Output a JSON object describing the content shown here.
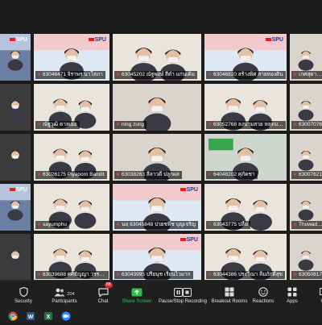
{
  "participants": [
    {
      "name": "",
      "scene": "logo-dark"
    },
    {
      "name": "63046471 จิราพร นาโสภา",
      "scene": "logo"
    },
    {
      "name": "63045202 ณัฐพงษ์ สีดำ แก่นเดิม",
      "scene": "two"
    },
    {
      "name": "63046820 สร้างพิศ สายทองดิน",
      "scene": "logo"
    },
    {
      "name": "เกศสุดา 6315",
      "scene": "plain"
    },
    {
      "name": "",
      "scene": "dark"
    },
    {
      "name": "ณัฐวุฒิ ตาลเยอ",
      "scene": "two"
    },
    {
      "name": "ning zung",
      "scene": "plain"
    },
    {
      "name": "63052768 ลงนามสวย หลุดบอส",
      "scene": "two"
    },
    {
      "name": "63007076",
      "scene": "plain"
    },
    {
      "name": "",
      "scene": "dark"
    },
    {
      "name": "63026175 Piyaporn Bandit",
      "scene": "two"
    },
    {
      "name": "63038263 ลีลาวดี ปลูกผล",
      "scene": "plain"
    },
    {
      "name": "64048202 ศุภัคชา",
      "scene": "green"
    },
    {
      "name": "63007621",
      "scene": "plain"
    },
    {
      "name": "",
      "scene": "logo-dark"
    },
    {
      "name": "sayumphu",
      "scene": "two"
    },
    {
      "name": "นฤ 63045848 ปวยชพีช บุญเจริญ",
      "scene": "logo"
    },
    {
      "name": "63043775 ปลื้ม",
      "scene": "two"
    },
    {
      "name": "Thuwadee",
      "scene": "plain"
    },
    {
      "name": "",
      "scene": "dark"
    },
    {
      "name": "63039688 ศศิธัญญา วรรณศรีสว่าง",
      "scene": "two"
    },
    {
      "name": "63043995 ปรียนุช เรียนไวมาก",
      "scene": "logo"
    },
    {
      "name": "63044386 ประวีณา ลิ้มภักดีสุข",
      "scene": "two"
    },
    {
      "name": "63050817",
      "scene": "plain"
    }
  ],
  "branding": {
    "logo_text": "SPU"
  },
  "toolbar": [
    {
      "id": "security",
      "label": "Security",
      "icon": "shield-icon"
    },
    {
      "id": "participants",
      "label": "Participants",
      "icon": "participants-icon",
      "count": "204"
    },
    {
      "id": "chat",
      "label": "Chat",
      "icon": "chat-icon",
      "badge": "88"
    },
    {
      "id": "share",
      "label": "Share Screen",
      "icon": "share-screen-icon"
    },
    {
      "id": "recording",
      "label": "Pause/Stop Recording",
      "icon": "pause-stop-icon"
    },
    {
      "id": "breakout",
      "label": "Breakout Rooms",
      "icon": "breakout-rooms-icon"
    },
    {
      "id": "reactions",
      "label": "Reactions",
      "icon": "reactions-icon"
    },
    {
      "id": "apps",
      "label": "Apps",
      "icon": "apps-icon"
    },
    {
      "id": "whiteboard",
      "label": "Wh",
      "icon": "whiteboard-icon"
    }
  ],
  "taskbar": [
    "chrome-icon",
    "word-icon",
    "excel-icon",
    "zoom-icon"
  ],
  "colors": {
    "share_green": "#2fbf4f",
    "mic_muted": "#e63c3c",
    "zoom_blue": "#2d8cff"
  }
}
